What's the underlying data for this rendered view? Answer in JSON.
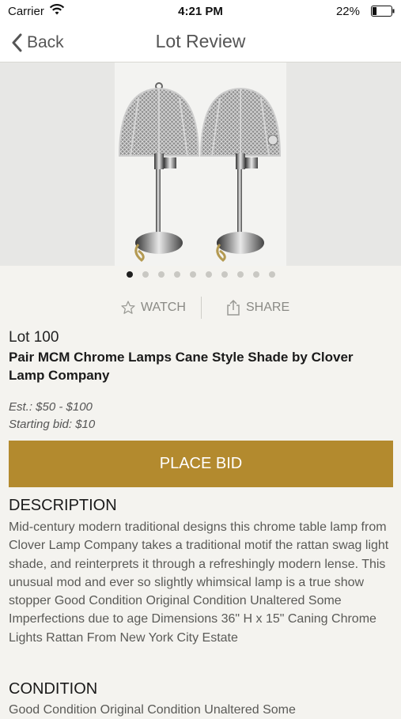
{
  "status_bar": {
    "carrier": "Carrier",
    "time": "4:21 PM",
    "battery": "22%",
    "battery_level": 0.22
  },
  "nav": {
    "back_label": "Back",
    "title": "Lot Review"
  },
  "gallery": {
    "image_subject": "Pair of chrome table lamps with cane style mesh shades",
    "total_images": 10,
    "active_index": 0
  },
  "actions": {
    "watch_label": "WATCH",
    "share_label": "SHARE"
  },
  "lot": {
    "number": "Lot 100",
    "title": "Pair MCM Chrome Lamps Cane Style Shade by Clover Lamp Company",
    "estimate": "Est.: $50 - $100",
    "starting_bid": "Starting bid: $10"
  },
  "bid_button_label": "PLACE BID",
  "description": {
    "heading": "DESCRIPTION",
    "body": "Mid-century modern traditional designs this chrome table lamp from Clover Lamp Company takes a traditional motif the rattan swag light shade, and reinterprets it through a refreshingly modern lense. This unusual mod and ever so slightly whimsical lamp is a true show stopper Good Condition Original Condition Unaltered Some Imperfections due to age Dimensions 36\" H x 15\" Caning Chrome Lights Rattan From New York City Estate"
  },
  "condition": {
    "heading": "CONDITION",
    "body": "Good Condition Original Condition Unaltered Some"
  },
  "colors": {
    "accent": "#b38a2e",
    "background": "#f4f3ef",
    "active_dot": "#1f1f1f",
    "inactive_dot": "#c9c8c3"
  }
}
